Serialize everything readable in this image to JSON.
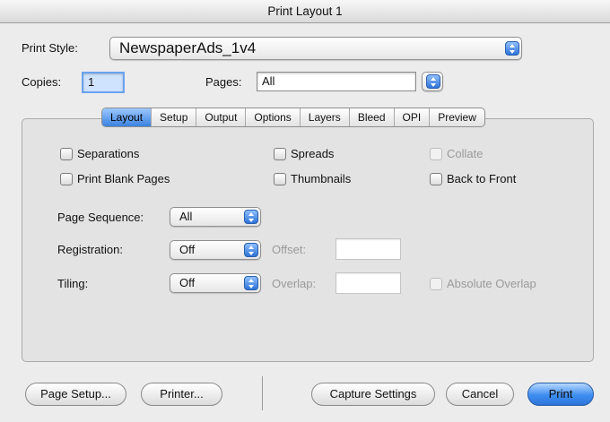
{
  "window": {
    "title": "Print Layout 1"
  },
  "header": {
    "print_style_label": "Print Style:",
    "print_style_value": "NewspaperAds_1v4",
    "copies_label": "Copies:",
    "copies_value": "1",
    "pages_label": "Pages:",
    "pages_value": "All"
  },
  "tabs": [
    "Layout",
    "Setup",
    "Output",
    "Options",
    "Layers",
    "Bleed",
    "OPI",
    "Preview"
  ],
  "active_tab": "Layout",
  "options": {
    "separations": "Separations",
    "spreads": "Spreads",
    "collate": "Collate",
    "print_blank_pages": "Print Blank Pages",
    "thumbnails": "Thumbnails",
    "back_to_front": "Back to Front"
  },
  "page_sequence": {
    "label": "Page Sequence:",
    "value": "All"
  },
  "registration": {
    "label": "Registration:",
    "value": "Off",
    "offset_label": "Offset:",
    "offset_value": ""
  },
  "tiling": {
    "label": "Tiling:",
    "value": "Off",
    "overlap_label": "Overlap:",
    "overlap_value": "",
    "absolute_overlap": "Absolute Overlap"
  },
  "buttons": {
    "page_setup": "Page Setup...",
    "printer": "Printer...",
    "capture_settings": "Capture Settings",
    "cancel": "Cancel",
    "print": "Print"
  },
  "colors": {
    "accent": "#3b82e0",
    "background": "#ececec"
  }
}
